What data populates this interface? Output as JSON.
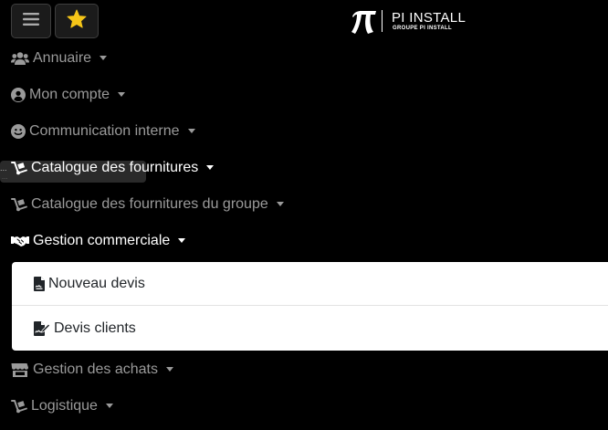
{
  "header": {
    "menu_button": {
      "icon": "hamburger-icon"
    },
    "favorites_button": {
      "icon": "star-icon",
      "color": "#f5c518"
    },
    "logo": {
      "symbol": "π",
      "name": "PI INSTALL",
      "subtitle": "GROUPE PI INSTALL"
    }
  },
  "nav": {
    "items": [
      {
        "label": "Annuaire",
        "icon": "users-icon"
      },
      {
        "label": "Mon compte",
        "icon": "user-circle-icon"
      },
      {
        "label": "Communication interne",
        "icon": "smile-icon"
      },
      {
        "label": "Catalogue des fournitures",
        "icon": "dolly-icon"
      },
      {
        "label": "Catalogue des fournitures du groupe",
        "icon": "dolly-icon"
      },
      {
        "label": "Gestion commerciale",
        "icon": "handshake-icon"
      },
      {
        "label": "Gestion des achats",
        "icon": "store-icon"
      },
      {
        "label": "Logistique",
        "icon": "dolly-icon"
      }
    ]
  },
  "tooltip": {
    "line1": "...",
    "line2": "..."
  },
  "dropdown": {
    "items": [
      {
        "label": "Nouveau devis",
        "icon": "file-invoice-icon"
      },
      {
        "label": "Devis clients",
        "icon": "file-signature-icon"
      }
    ]
  },
  "colors": {
    "background": "#000000",
    "nav_text": "#9a9a9a",
    "nav_text_active": "#ffffff",
    "dropdown_bg": "#ffffff",
    "star": "#f5c518"
  }
}
